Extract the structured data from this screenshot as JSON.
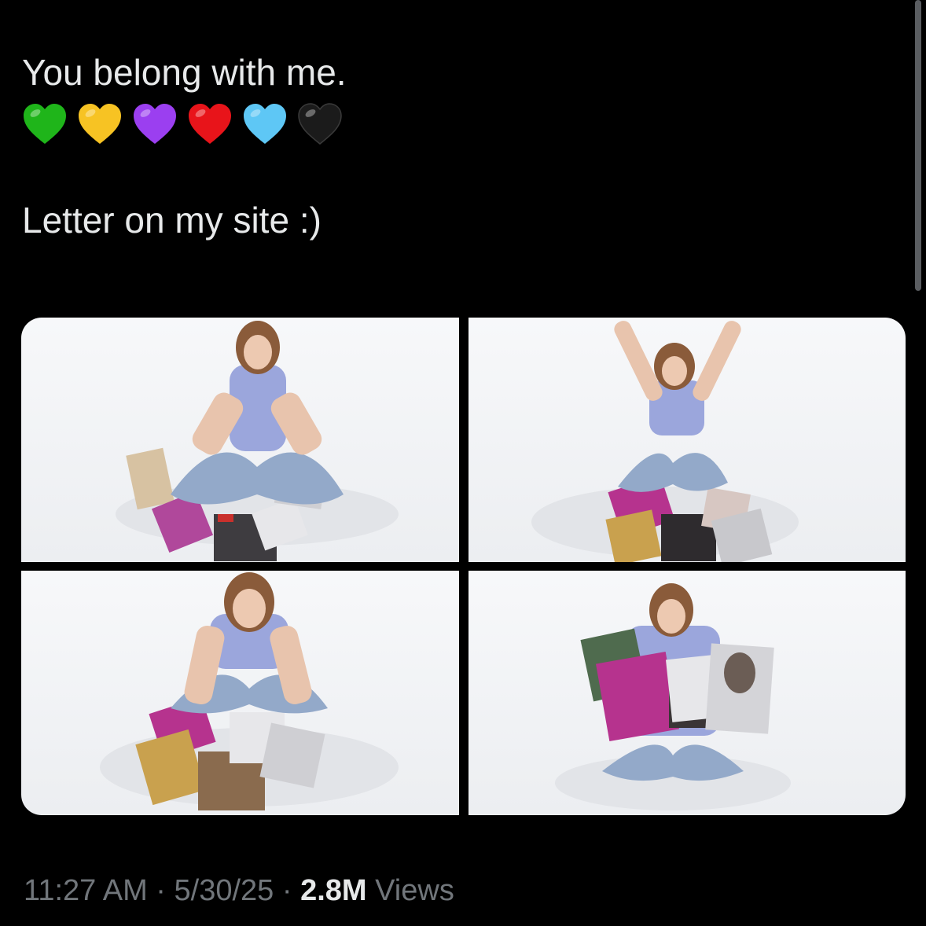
{
  "tweet": {
    "line1": "You belong with me.",
    "hearts": [
      {
        "icon": "green-heart-icon",
        "color": "#1fb51a"
      },
      {
        "icon": "yellow-heart-icon",
        "color": "#f7c323"
      },
      {
        "icon": "purple-heart-icon",
        "color": "#9b3ff0"
      },
      {
        "icon": "red-heart-icon",
        "color": "#e8141a"
      },
      {
        "icon": "light-blue-heart-icon",
        "color": "#5ec7f5"
      },
      {
        "icon": "black-heart-icon",
        "color": "#1b1b1b"
      }
    ],
    "line2": "Letter on my site :)"
  },
  "media": {
    "photos": [
      {
        "pose": "sitting-hands-down"
      },
      {
        "pose": "arms-raised"
      },
      {
        "pose": "leaning-forward"
      },
      {
        "pose": "holding-albums"
      }
    ]
  },
  "meta": {
    "time": "11:27 AM",
    "sep1": " · ",
    "date": "5/30/25",
    "sep2": " · ",
    "views_count": "2.8M",
    "views_label": " Views"
  }
}
